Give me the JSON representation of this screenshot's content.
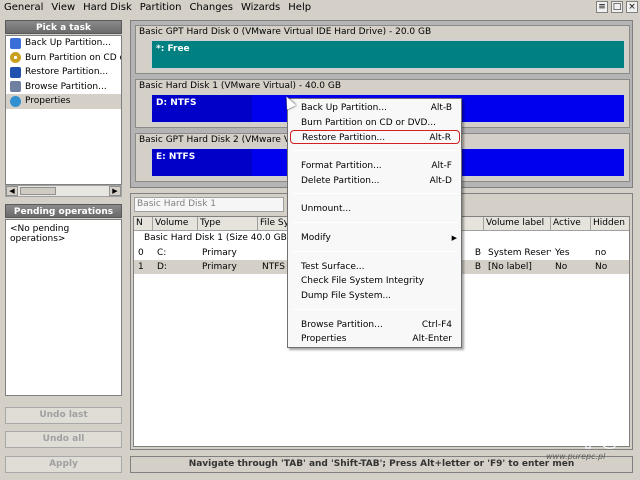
{
  "menubar": {
    "items": [
      "General",
      "View",
      "Hard Disk",
      "Partition",
      "Changes",
      "Wizards",
      "Help"
    ]
  },
  "window_controls": [
    "≡",
    "□",
    "×"
  ],
  "pick_task": {
    "title": "Pick a task",
    "items": [
      {
        "label": "Back Up Partition...",
        "icon": "backup-icon",
        "color": "#3a6fd8"
      },
      {
        "label": "Burn Partition on CD o",
        "icon": "burn-cd-icon",
        "color": "#c8a020"
      },
      {
        "label": "Restore Partition...",
        "icon": "restore-icon",
        "color": "#2050b0"
      },
      {
        "label": "Browse Partition...",
        "icon": "browse-icon",
        "color": "#7080a0"
      },
      {
        "label": "Properties",
        "icon": "properties-icon",
        "color": "#3090d0"
      }
    ]
  },
  "pending": {
    "title": "Pending operations",
    "empty": "<No pending operations>"
  },
  "buttons": {
    "undo_last": "Undo last",
    "undo_all": "Undo all",
    "apply": "Apply"
  },
  "disks": [
    {
      "label": "Basic GPT Hard Disk 0 (VMware Virtual IDE Hard Drive) - 20.0 GB",
      "partition": "*: Free",
      "color": "#008080"
    },
    {
      "label": "Basic Hard Disk 1 (VMware Virtual) - 40.0 GB",
      "partition": "D: NTFS",
      "color": "#0000ee"
    },
    {
      "label": "Basic GPT Hard Disk 2 (VMware Virtual",
      "partition": "E: NTFS",
      "color": "#0000ee"
    }
  ],
  "properties": {
    "combo": "Basic Hard Disk 1",
    "columns": [
      "N",
      "Volume",
      "Type",
      "File Sy",
      "",
      "Volume label",
      "Active",
      "Hidden"
    ],
    "group": "Basic Hard Disk 1 (Size 40.0 GB)",
    "rows": [
      {
        "n": "0",
        "volume": "C:",
        "type": "Primary",
        "fs": "",
        "size": "B",
        "label": "System Reserv",
        "active": "Yes",
        "hidden": "no"
      },
      {
        "n": "1",
        "volume": "D:",
        "type": "Primary",
        "fs": "NTFS",
        "size": "B",
        "label": "[No label]",
        "active": "No",
        "hidden": "No"
      }
    ]
  },
  "status": "Navigate through 'TAB' and 'Shift-TAB'; Press Alt+letter or 'F9' to enter men",
  "context_menu": {
    "backup": {
      "label": "Back Up Partition...",
      "shortcut": "Alt-B"
    },
    "burn": {
      "label": "Burn Partition on CD or DVD..."
    },
    "restore": {
      "label": "Restore Partition...",
      "shortcut": "Alt-R"
    },
    "format": {
      "label": "Format Partition...",
      "shortcut": "Alt-F"
    },
    "delete": {
      "label": "Delete Partition...",
      "shortcut": "Alt-D"
    },
    "unmount": {
      "label": "Unmount..."
    },
    "modify": {
      "label": "Modify",
      "submenu": "▶"
    },
    "test": {
      "label": "Test Surface..."
    },
    "check": {
      "label": "Check File System Integrity"
    },
    "dump": {
      "label": "Dump File System..."
    },
    "browse": {
      "label": "Browse Partition...",
      "shortcut": "Ctrl-F4"
    },
    "properties": {
      "label": "Properties",
      "shortcut": "Alt-Enter"
    }
  },
  "watermark": {
    "brand": "PURE PC",
    "url": "www.purepc.pl"
  }
}
